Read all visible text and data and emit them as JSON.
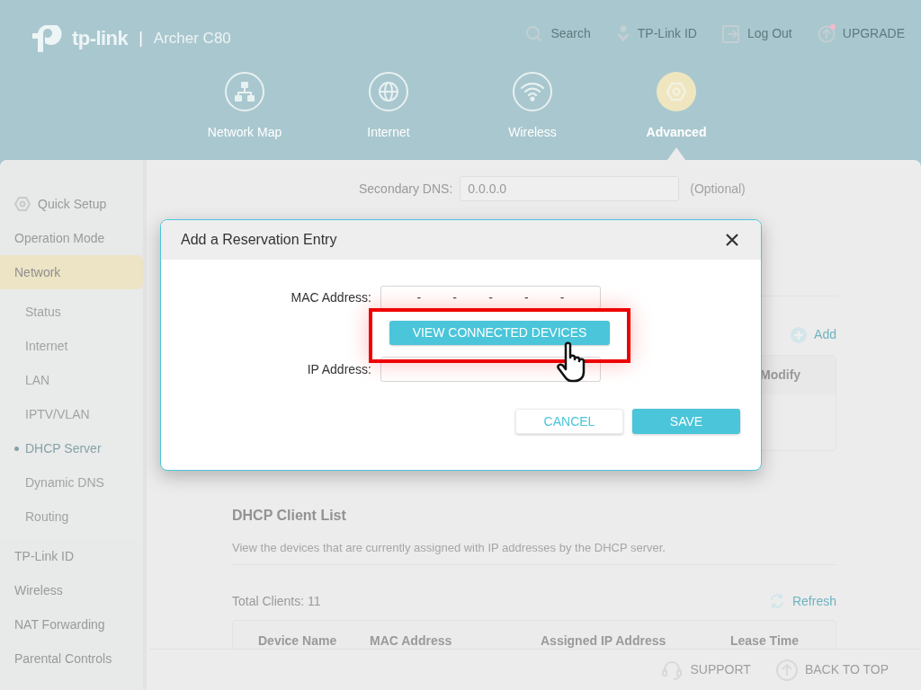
{
  "header": {
    "brand": "tp-link",
    "divider": "|",
    "model": "Archer C80",
    "top_links": [
      {
        "label": "Search",
        "kind": "search",
        "notification": false
      },
      {
        "label": "TP-Link ID",
        "kind": "id",
        "notification": false
      },
      {
        "label": "Log Out",
        "kind": "logout",
        "notification": false
      },
      {
        "label": "UPGRADE",
        "kind": "upgrade",
        "notification": true
      }
    ],
    "nav_tabs": [
      {
        "label": "Network Map",
        "kind": "map",
        "selected": false
      },
      {
        "label": "Internet",
        "kind": "globe",
        "selected": false
      },
      {
        "label": "Wireless",
        "kind": "wifi",
        "selected": false
      },
      {
        "label": "Advanced",
        "kind": "gear",
        "selected": true
      }
    ]
  },
  "sidebar": {
    "items": [
      {
        "label": "Quick Setup",
        "kind": "setup",
        "selected": false
      },
      {
        "label": "Operation Mode",
        "selected": false
      },
      {
        "label": "Network",
        "selected": true,
        "children": [
          {
            "label": "Status",
            "selected": false
          },
          {
            "label": "Internet",
            "selected": false
          },
          {
            "label": "LAN",
            "selected": false
          },
          {
            "label": "IPTV/VLAN",
            "selected": false
          },
          {
            "label": "DHCP Server",
            "selected": true
          },
          {
            "label": "Dynamic DNS",
            "selected": false
          },
          {
            "label": "Routing",
            "selected": false
          }
        ]
      },
      {
        "label": "TP-Link ID",
        "selected": false
      },
      {
        "label": "Wireless",
        "selected": false
      },
      {
        "label": "NAT Forwarding",
        "selected": false
      },
      {
        "label": "Parental Controls",
        "selected": false
      }
    ]
  },
  "content": {
    "secondary_dns": {
      "label": "Secondary DNS:",
      "value": "0.0.0.0",
      "hint": "(Optional)"
    },
    "add_link": "Add",
    "reservation_table": {
      "columns": [
        "Modify"
      ]
    },
    "client_list": {
      "title": "DHCP Client List",
      "description": "View the devices that are currently assigned with IP addresses by the DHCP server.",
      "total": "Total Clients: 11",
      "refresh": "Refresh",
      "columns": [
        "Device Name",
        "MAC Address",
        "Assigned IP Address",
        "Lease Time"
      ]
    }
  },
  "dialog": {
    "title": "Add a Reservation Entry",
    "mac_label": "MAC Address:",
    "mac_separators": [
      "-",
      "-",
      "-",
      "-",
      "-"
    ],
    "view_button": "VIEW CONNECTED DEVICES",
    "ip_label": "IP Address:",
    "buttons": [
      {
        "label": "CANCEL",
        "kind": "secondary"
      },
      {
        "label": "SAVE",
        "kind": "primary"
      }
    ]
  },
  "footer": {
    "links": [
      {
        "label": "SUPPORT",
        "kind": "support"
      },
      {
        "label": "BACK TO TOP",
        "kind": "top"
      }
    ]
  }
}
